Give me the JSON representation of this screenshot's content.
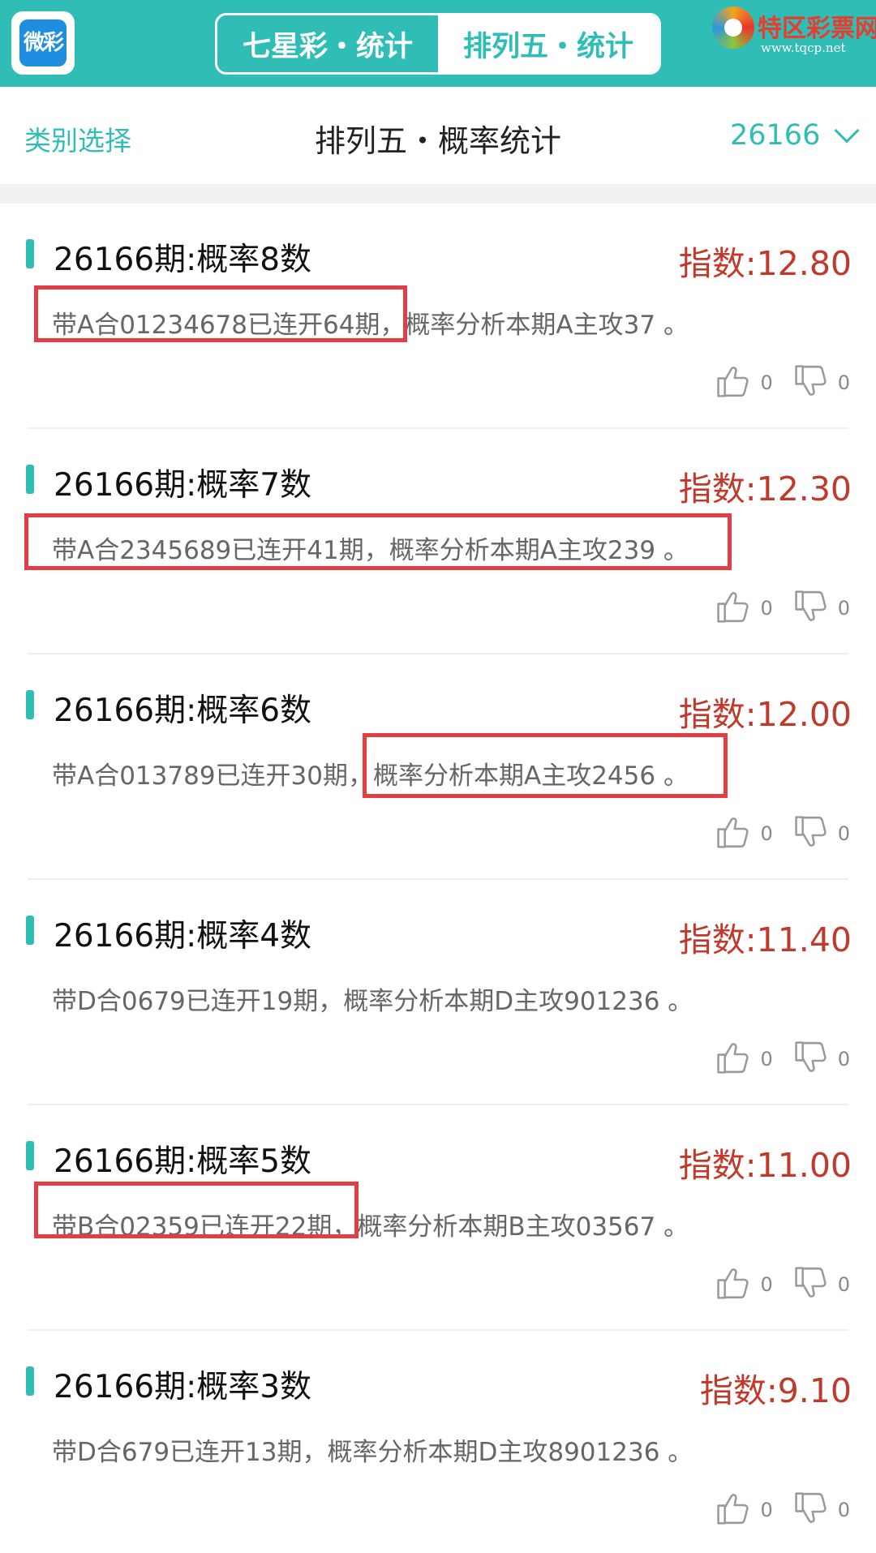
{
  "header": {
    "app_logo_text": "微彩",
    "tabs": [
      {
        "label": "七星彩・统计",
        "active": false
      },
      {
        "label": "排列五・统计",
        "active": true
      }
    ],
    "brand_name": "特区彩票网",
    "brand_url": "www.tqcp.net"
  },
  "nav": {
    "category_label": "类别选择",
    "title": "排列五・概率统计",
    "issue": "26166"
  },
  "colors": {
    "accent": "#2fbdb6",
    "index": "#c0392b",
    "highlight": "#e53d44"
  },
  "cards": [
    {
      "title": "26166期:概率8数",
      "index": "指数:12.80",
      "text": "带A合01234678已连开64期，概率分析本期A主攻37 。",
      "up": "0",
      "down": "0"
    },
    {
      "title": "26166期:概率7数",
      "index": "指数:12.30",
      "text": "带A合2345689已连开41期，概率分析本期A主攻239 。",
      "up": "0",
      "down": "0"
    },
    {
      "title": "26166期:概率6数",
      "index": "指数:12.00",
      "text": "带A合013789已连开30期，概率分析本期A主攻2456 。",
      "up": "0",
      "down": "0"
    },
    {
      "title": "26166期:概率4数",
      "index": "指数:11.40",
      "text": "带D合0679已连开19期，概率分析本期D主攻901236 。",
      "up": "0",
      "down": "0"
    },
    {
      "title": "26166期:概率5数",
      "index": "指数:11.00",
      "text": "带B合02359已连开22期，概率分析本期B主攻03567 。",
      "up": "0",
      "down": "0"
    },
    {
      "title": "26166期:概率3数",
      "index": "指数:9.10",
      "text": "带D合679已连开13期，概率分析本期D主攻8901236 。",
      "up": "0",
      "down": "0"
    }
  ],
  "icons": {
    "up": "thumbs-up-icon",
    "down": "thumbs-down-icon",
    "dropdown": "chevron-down-icon"
  }
}
